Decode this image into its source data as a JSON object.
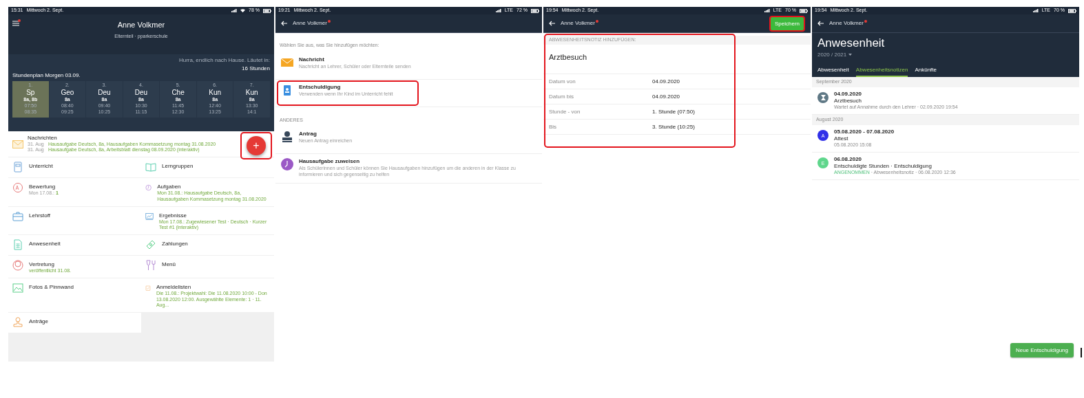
{
  "home_screen": {
    "status_bar": {
      "time": "15:31",
      "date": "Mittwoch 2. Sept.",
      "battery": "78 %"
    },
    "header": {
      "name": "Anne Volkmer",
      "subtitle": "Elternteil · pparkerschule"
    },
    "countdown": {
      "text": "Hurra, endlich nach Hause. Läutet in:",
      "value": "16 Stunden"
    },
    "schedule": {
      "title": "Stundenplan Morgen 03.09.",
      "lessons": [
        {
          "number": "1.",
          "subject": "Sp",
          "group": "8a, 8b",
          "start": "07:50",
          "end": "08:35",
          "selected": true
        },
        {
          "number": "2.",
          "subject": "Geo",
          "group": "8a",
          "start": "08:40",
          "end": "09:25",
          "selected": false
        },
        {
          "number": "3.",
          "subject": "Deu",
          "group": "8a",
          "start": "09:40",
          "end": "10:25",
          "selected": false
        },
        {
          "number": "4.",
          "subject": "Deu",
          "group": "8a",
          "start": "10:30",
          "end": "11:15",
          "selected": false
        },
        {
          "number": "5.",
          "subject": "Che",
          "group": "8a",
          "start": "11:45",
          "end": "12:30",
          "selected": false
        },
        {
          "number": "6.",
          "subject": "Kun",
          "group": "8a",
          "start": "12:40",
          "end": "13:25",
          "selected": false
        },
        {
          "number": "7.",
          "subject": "Kun",
          "group": "8a",
          "start": "13:30",
          "end": "14:1",
          "selected": false
        }
      ]
    },
    "add_button": {
      "label": "+",
      "highlighted": true
    },
    "messages": {
      "title": "Nachrichten",
      "entries": [
        {
          "date": "31. Aug",
          "text": "Hausaufgabe Deutsch, 8a, Hausaufgaben Kommasetzung montag 31.08.2020"
        },
        {
          "date": "31. Aug",
          "text": "Hausaufgabe Deutsch, 8a, Arbeitsblatt dienstag 08.09.2020 (interaktiv)"
        }
      ]
    },
    "tiles": [
      {
        "kind": "book",
        "title": "Unterricht"
      },
      {
        "kind": "open-book",
        "title": "Lerngruppen"
      },
      {
        "kind": "grade",
        "title": "Bewertung",
        "detail_date": "Mon 17.08.:",
        "detail": "1"
      },
      {
        "kind": "clock",
        "title": "Aufgaben",
        "detail": "Mon 31.08.: Hausaufgabe Deutsch, 8a, Hausaufgaben Kommasetzung montag 31.08.2020"
      },
      {
        "kind": "briefcase",
        "title": "Lehrstoff"
      },
      {
        "kind": "chart",
        "title": "Ergebnisse",
        "detail": "Mon 17.08.: Zugewiesener Test · Deutsch · Kurzer Test #1 (interaktiv)"
      },
      {
        "kind": "sheet",
        "title": "Anwesenheit"
      },
      {
        "kind": "money",
        "title": "Zahlungen"
      },
      {
        "kind": "person",
        "title": "Vertretung",
        "detail": "veröffentlicht 31.08."
      },
      {
        "kind": "cutlery",
        "title": "Menü"
      },
      {
        "kind": "photo",
        "title": "Fotos & Pinnwand"
      },
      {
        "kind": "clipboard",
        "title": "Anmeldelisten",
        "detail": "Die 11.08.: Projektwahl: Die 11.08.2020 10:00 - Don 13.08.2020 12:00. Ausgewählte Elemente: 1 · 11. Aug..."
      },
      {
        "kind": "stamp",
        "title": "Anträge"
      }
    ]
  },
  "add_screen": {
    "status_bar": {
      "time": "19:21",
      "date": "Mittwoch 2. Sept.",
      "network": "LTE",
      "battery": "72 %"
    },
    "title": "Anne Volkmer",
    "prompt": "Wählen Sie aus, was Sie hinzufügen möchten:",
    "options": [
      {
        "kind": "envelope",
        "title": "Nachricht",
        "description": "Nachricht an Lehrer, Schüler oder Elternteile senden",
        "highlighted": false
      },
      {
        "kind": "badge",
        "title": "Entschuldigung",
        "description": "Verwenden wenn Ihr Kind im Unterricht fehlt",
        "highlighted": true
      }
    ],
    "other_section": "ANDERES",
    "other_options": [
      {
        "kind": "stamp",
        "title": "Antrag",
        "description": "Neuen Antrag einreichen",
        "highlighted": false
      },
      {
        "kind": "clock",
        "title": "Hausaufgabe zuweisen",
        "description": "Als Schülerinnen und Schüler können Sie Hausaufgaben hinzufügen um die anderen in der Klasse zu informieren und sich gegenseitig zu helfen",
        "highlighted": false
      }
    ]
  },
  "absence_note_screen": {
    "status_bar": {
      "time": "19:54",
      "date": "Mittwoch 2. Sept.",
      "network": "LTE",
      "battery": "70 %"
    },
    "title": "Anne Volkmer",
    "save_button": {
      "label": "Speichern",
      "highlighted": true
    },
    "form": {
      "section_label": "ABWESENHEITSNOTIZ HINZUFÜGEN:",
      "note": "Arztbesuch",
      "highlighted": true,
      "fields": [
        {
          "label": "Datum von",
          "value": "04.09.2020"
        },
        {
          "label": "Datum bis",
          "value": "04.09.2020"
        },
        {
          "label": "Stunde - von",
          "value": "1. Stunde (07:50)"
        },
        {
          "label": "Bis",
          "value": "3. Stunde (10:25)"
        }
      ]
    }
  },
  "attendance_screen": {
    "status_bar": {
      "time": "19:54",
      "date": "Mittwoch 2. Sept.",
      "network": "LTE",
      "battery": "70 %"
    },
    "title": "Anne Volkmer",
    "heading": "Anwesenheit",
    "year": "2020 / 2021",
    "tabs": [
      {
        "label": "Abwesenheit",
        "selected": false
      },
      {
        "label": "Abwesenheitsnotizen",
        "selected": true
      },
      {
        "label": "Ankünfte",
        "selected": false
      }
    ],
    "groups": [
      {
        "month": "September 2020",
        "entries": [
          {
            "kind": "icon",
            "color": "#5f7885",
            "date": "04.09.2020",
            "title": "Arztbesuch",
            "meta": "Wartet auf Annahme durch den Lehrer · 02.09.2020 19:54"
          }
        ]
      },
      {
        "month": "August 2020",
        "entries": [
          {
            "kind": "letter",
            "letter": "A",
            "color": "#3030e8",
            "date": "05.08.2020 - 07.08.2020",
            "title": "Attest",
            "meta": "05.08.2020 15:08"
          },
          {
            "kind": "letter",
            "letter": "E",
            "color": "#5fd68c",
            "date": "06.08.2020",
            "title": "Entschuldigte Stunden · Entschuldigung",
            "status": "ANGENOMMEN",
            "meta": "· Abwesenheitsnotiz · 06.08.2020 12:36"
          }
        ]
      }
    ],
    "new_button": "Neue Entschuldigung"
  }
}
